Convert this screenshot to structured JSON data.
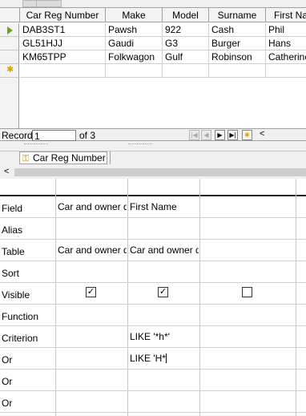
{
  "grid": {
    "columns": [
      "Car Reg Number",
      "Make",
      "Model",
      "Surname",
      "First Na"
    ],
    "rows": [
      [
        "DAB3ST1",
        "Pawsh",
        "922",
        "Cash",
        "Phil"
      ],
      [
        "GL51HJJ",
        "Gaudi",
        "G3",
        "Burger",
        "Hans"
      ],
      [
        "KM65TPP",
        "Folkwagon",
        "Gulf",
        "Robinson",
        "Catherine"
      ]
    ]
  },
  "record_nav": {
    "label": "Record",
    "value": "1",
    "of_text": "of 3",
    "buttons": [
      "first",
      "previous",
      "next",
      "last",
      "new"
    ]
  },
  "table_window": {
    "title": "Car Reg Number"
  },
  "design": {
    "row_labels": [
      "Field",
      "Alias",
      "Table",
      "Sort",
      "Visible",
      "Function",
      "Criterion",
      "Or",
      "Or",
      "Or"
    ],
    "columns": [
      {
        "field": "Car and owner d",
        "alias": "",
        "table": "Car and owner d",
        "visible": true,
        "criterion": "",
        "or1": ""
      },
      {
        "field": "First Name",
        "alias": "",
        "table": "Car and owner d",
        "visible": true,
        "criterion": "LIKE '*h*'",
        "or1": "LIKE 'H*"
      },
      {
        "field": "",
        "alias": "",
        "table": "",
        "visible": false,
        "criterion": "",
        "or1": ""
      }
    ]
  },
  "colors": {
    "current_row_arrow": "#6fa020",
    "new_row_star": "#d6a600"
  }
}
